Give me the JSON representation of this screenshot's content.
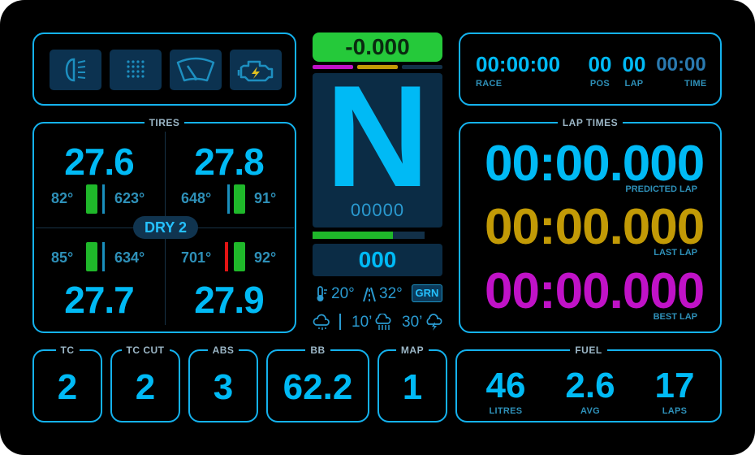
{
  "icons": [
    "headlight-icon",
    "rain-light-icon",
    "wiper-icon",
    "engine-icon"
  ],
  "delta": {
    "value": "-0.000",
    "color": "#25c93a"
  },
  "gear": {
    "value": "N",
    "rpm": "00000"
  },
  "speed": "000",
  "weather": {
    "air_temp": "20°",
    "track_temp": "32°",
    "flag": "GRN",
    "forecast_10": "10’",
    "forecast_30": "30’"
  },
  "race": {
    "race_time": "00:00:00",
    "race_label": "RACE",
    "position": "00",
    "position_label": "POS",
    "lap": "00",
    "lap_label": "LAP",
    "time": "00:00",
    "time_label": "TIME"
  },
  "tires": {
    "title": "TIRES",
    "compound": "DRY 2",
    "fl": {
      "pressure": "27.6",
      "temp_left": "82°",
      "temp_right": "623°"
    },
    "fr": {
      "pressure": "27.8",
      "temp_left": "648°",
      "temp_right": "91°"
    },
    "rl": {
      "pressure": "27.7",
      "temp_left": "85°",
      "temp_right": "634°"
    },
    "rr": {
      "pressure": "27.9",
      "temp_left": "701°",
      "temp_right": "92°"
    }
  },
  "lap_times": {
    "title": "LAP TIMES",
    "predicted": {
      "value": "00:00.000",
      "label": "PREDICTED LAP",
      "color": "#00baf5"
    },
    "last": {
      "value": "00:00.000",
      "label": "LAST LAP",
      "color": "#c29a06"
    },
    "best": {
      "value": "00:00.000",
      "label": "BEST LAP",
      "color": "#c012c7"
    }
  },
  "settings": {
    "tc": {
      "label": "TC",
      "value": "2"
    },
    "tc_cut": {
      "label": "TC CUT",
      "value": "2"
    },
    "abs": {
      "label": "ABS",
      "value": "3"
    },
    "bb": {
      "label": "BB",
      "value": "62.2"
    },
    "map": {
      "label": "MAP",
      "value": "1"
    }
  },
  "fuel": {
    "title": "FUEL",
    "litres": "46",
    "litres_label": "LITRES",
    "avg": "2.6",
    "avg_label": "AVG",
    "laps": "17",
    "laps_label": "LAPS"
  },
  "bars": {
    "throttle_fill": 0.72
  }
}
